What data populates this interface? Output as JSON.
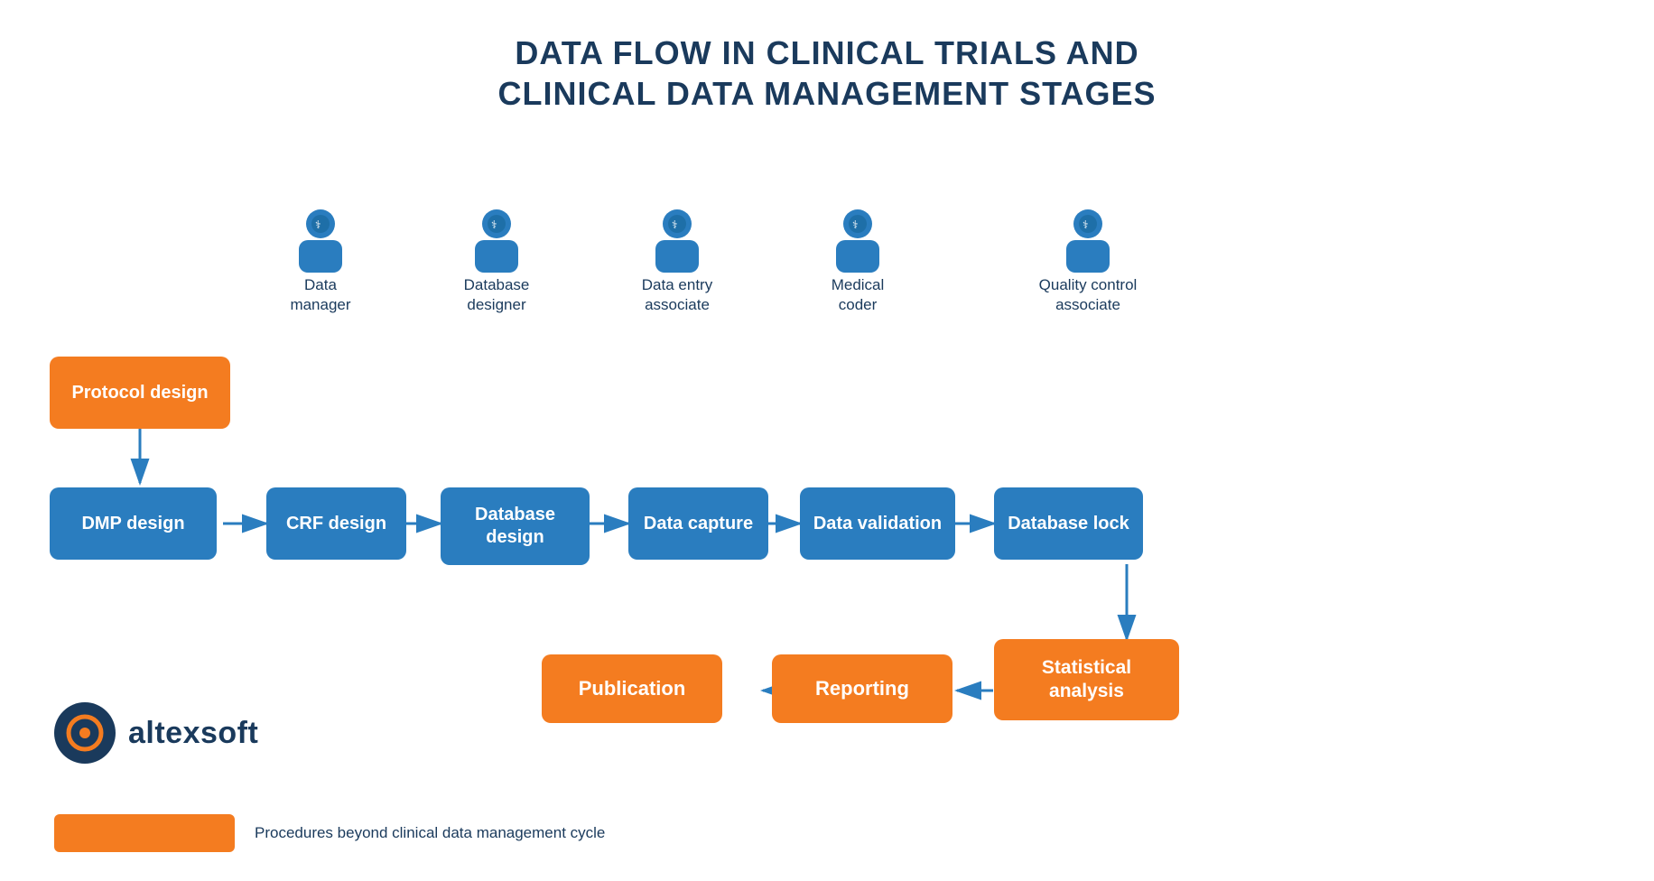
{
  "title": {
    "line1": "DATA FLOW IN CLINICAL TRIALS AND",
    "line2": "CLINICAL DATA MANAGEMENT STAGES"
  },
  "colors": {
    "blue_dark": "#1a3a5c",
    "blue_mid": "#2a7dbf",
    "orange": "#f47c20",
    "arrow": "#2a7dbf"
  },
  "persons": [
    {
      "id": "data-manager",
      "label": "Data\nmanager"
    },
    {
      "id": "database-designer",
      "label": "Database\ndesigner"
    },
    {
      "id": "data-entry-associate",
      "label": "Data entry\nassociate"
    },
    {
      "id": "medical-coder",
      "label": "Medical\ncoder"
    },
    {
      "id": "quality-control-associate",
      "label": "Quality control\nassociate"
    }
  ],
  "process_boxes_top": [
    {
      "id": "protocol-design",
      "label": "Protocol design",
      "type": "orange"
    },
    {
      "id": "dmp-design",
      "label": "DMP design",
      "type": "blue"
    },
    {
      "id": "crf-design",
      "label": "CRF design",
      "type": "blue"
    },
    {
      "id": "database-design",
      "label": "Database design",
      "type": "blue"
    },
    {
      "id": "data-capture",
      "label": "Data capture",
      "type": "blue"
    },
    {
      "id": "data-validation",
      "label": "Data validation",
      "type": "blue"
    },
    {
      "id": "database-lock",
      "label": "Database lock",
      "type": "blue"
    }
  ],
  "process_boxes_bottom": [
    {
      "id": "statistical-analysis",
      "label": "Statistical\nanalysis",
      "type": "orange"
    },
    {
      "id": "reporting",
      "label": "Reporting",
      "type": "orange"
    },
    {
      "id": "publication",
      "label": "Publication",
      "type": "orange"
    }
  ],
  "logo": {
    "brand": "altexsoft"
  },
  "legend": {
    "label": "Procedures beyond clinical data management cycle"
  }
}
